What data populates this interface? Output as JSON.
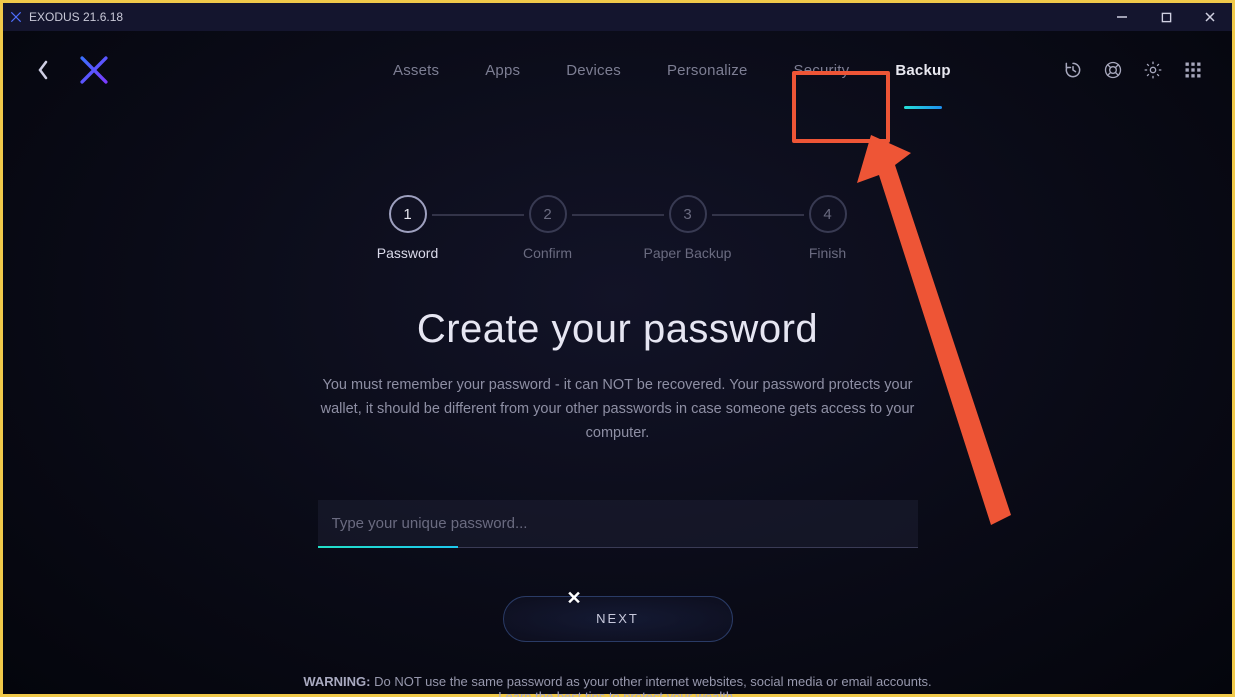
{
  "window": {
    "title": "EXODUS 21.6.18"
  },
  "nav": {
    "items": [
      {
        "label": "Assets"
      },
      {
        "label": "Apps"
      },
      {
        "label": "Devices"
      },
      {
        "label": "Personalize"
      },
      {
        "label": "Security"
      },
      {
        "label": "Backup",
        "active": true
      }
    ]
  },
  "stepper": {
    "steps": [
      {
        "num": "1",
        "label": "Password",
        "active": true
      },
      {
        "num": "2",
        "label": "Confirm"
      },
      {
        "num": "3",
        "label": "Paper Backup"
      },
      {
        "num": "4",
        "label": "Finish"
      }
    ]
  },
  "main": {
    "headline": "Create your password",
    "subtext": "You must remember your password - it can NOT be recovered. Your password protects your wallet, it should be different from your other passwords in case someone gets access to your computer.",
    "password_placeholder": "Type your unique password...",
    "next_label": "NEXT",
    "warning_prefix": "WARNING: ",
    "warning_text": "Do NOT use the same password as your other internet websites, social media or email accounts.",
    "learn_link": "Learn the best tips to protect your wealth."
  }
}
